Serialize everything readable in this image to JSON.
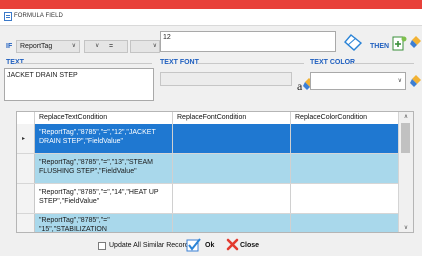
{
  "window": {
    "title": "FORMULA FIELD"
  },
  "condition": {
    "if_label": "IF",
    "field_value": "ReportTag",
    "operator_value": "=",
    "operator2_value": "",
    "compare_value": "12",
    "then_label": "THEN"
  },
  "text_section": {
    "label": "TEXT",
    "value": "JACKET DRAIN STEP"
  },
  "font_section": {
    "label": "TEXT FONT",
    "value": ""
  },
  "color_section": {
    "label": "TEXT COLOR",
    "value": ""
  },
  "grid": {
    "columns": [
      "ReplaceTextCondition",
      "ReplaceFontCondition",
      "ReplaceColorCondition"
    ],
    "rows": [
      {
        "text": "\"ReportTag\",\"8785\",\"=\",\"12\",\"JACKET DRAIN STEP\",\"FieldValue\"",
        "font": "",
        "color": "",
        "selected": true
      },
      {
        "text": "\"ReportTag\",\"8785\",\"=\",\"13\",\"STEAM FLUSHING STEP\",\"FieldValue\"",
        "font": "",
        "color": ""
      },
      {
        "text": "\"ReportTag\",\"8785\",\"=\",\"14\",\"HEAT UP STEP\",\"FieldValue\"",
        "font": "",
        "color": ""
      },
      {
        "text": "\"ReportTag\",\"8785\",\"=\" \"15\",\"STABILIZATION",
        "font": "",
        "color": ""
      }
    ]
  },
  "footer": {
    "checkbox_label": "Update All Similar Records",
    "ok_label": "Ok",
    "close_label": "Close"
  },
  "colors": {
    "accent_red": "#e8413a",
    "label_blue": "#1f5fbf",
    "selected_row": "#1f78d1",
    "alt_row": "#a9d8eb"
  }
}
